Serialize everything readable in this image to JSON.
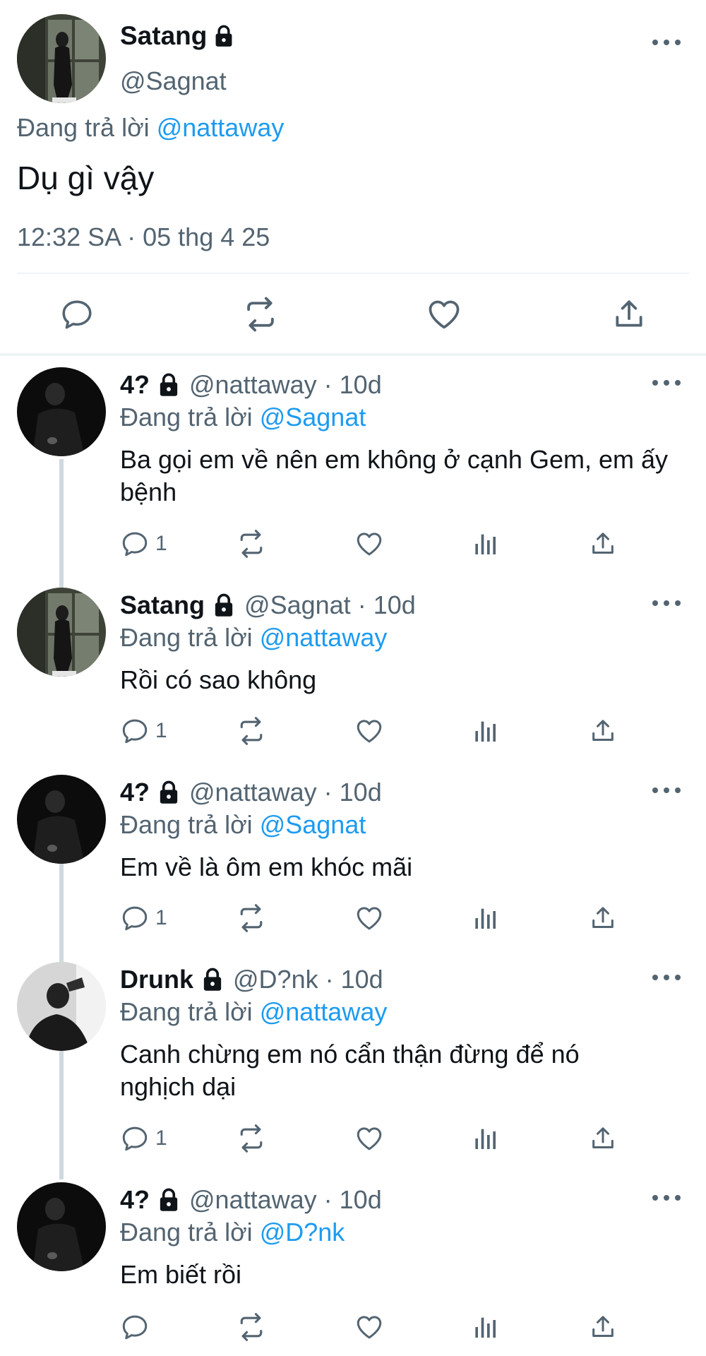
{
  "main_tweet": {
    "name": "Satang",
    "handle": "@Sagnat",
    "replying_prefix": "Đang trả lời",
    "replying_to": "@nattaway",
    "text": "Dụ gì vậy",
    "meta": "12:32 SA · 05 thg 4 25",
    "avatar_icon": "avatar-photo-locker",
    "actions": [
      "reply-icon",
      "retweet-icon",
      "like-icon",
      "share-icon"
    ]
  },
  "replies": [
    {
      "name": "4?",
      "handle": "@nattaway",
      "dot": "·",
      "time": "10d",
      "replying_prefix": "Đang trả lời",
      "replying_to": "@Sagnat",
      "text": "Ba gọi em về nên em không ở cạnh Gem, em ấy bệnh",
      "reply_count": "1",
      "avatar_icon": "avatar-photo-dark"
    },
    {
      "name": "Satang",
      "handle": "@Sagnat",
      "dot": "·",
      "time": "10d",
      "replying_prefix": "Đang trả lời",
      "replying_to": "@nattaway",
      "text": "Rồi có sao không",
      "reply_count": "1",
      "avatar_icon": "avatar-photo-locker"
    },
    {
      "name": "4?",
      "handle": "@nattaway",
      "dot": "·",
      "time": "10d",
      "replying_prefix": "Đang trả lời",
      "replying_to": "@Sagnat",
      "text": "Em về là ôm em khóc mãi",
      "reply_count": "1",
      "avatar_icon": "avatar-photo-dark"
    },
    {
      "name": "Drunk",
      "handle": "@D?nk",
      "dot": "·",
      "time": "10d",
      "replying_prefix": "Đang trả lời",
      "replying_to": "@nattaway",
      "text": "Canh chừng em nó cẩn thận đừng để nó nghịch dại",
      "reply_count": "1",
      "avatar_icon": "avatar-photo-grey"
    },
    {
      "name": "4?",
      "handle": "@nattaway",
      "dot": "·",
      "time": "10d",
      "replying_prefix": "Đang trả lời",
      "replying_to": "@D?nk",
      "text": "Em biết rồi",
      "reply_count": "",
      "avatar_icon": "avatar-photo-dark"
    }
  ],
  "colors": {
    "accent": "#1d9bf0",
    "secondary_text": "#536471",
    "primary_text": "#0f1419",
    "thread_line": "#cfd9de"
  }
}
